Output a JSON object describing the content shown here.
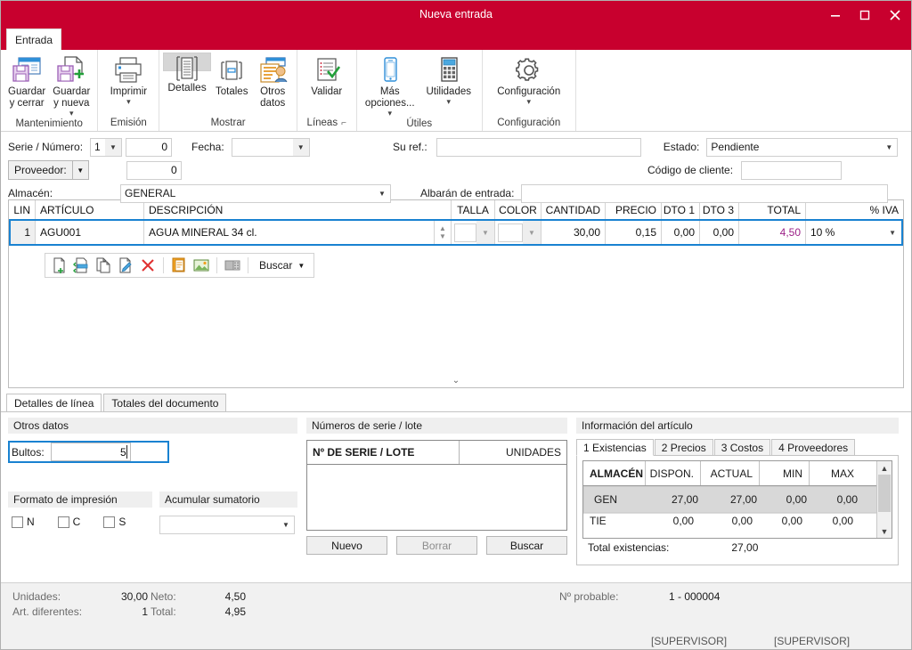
{
  "window": {
    "title": "Nueva entrada",
    "minimize": "–",
    "maximize": "□",
    "close": "✕"
  },
  "ribbon": {
    "tab_label": "Entrada",
    "groups": [
      {
        "label": "Mantenimiento",
        "buttons": [
          {
            "label": "Guardar\ny cerrar",
            "icon": "save-close-icon",
            "caret": false
          },
          {
            "label": "Guardar\ny nueva",
            "icon": "save-new-icon",
            "caret": true
          }
        ]
      },
      {
        "label": "Emisión",
        "buttons": [
          {
            "label": "Imprimir",
            "icon": "printer-icon",
            "caret": true
          }
        ]
      },
      {
        "label": "Mostrar",
        "buttons": [
          {
            "label": "Detalles",
            "icon": "details-icon",
            "caret": false,
            "selected": true
          },
          {
            "label": "Totales",
            "icon": "totals-icon",
            "caret": false
          },
          {
            "label": "Otros\ndatos",
            "icon": "other-data-icon",
            "caret": false
          }
        ]
      },
      {
        "label": "Líneas",
        "dialog_launcher": "⊿",
        "buttons": [
          {
            "label": "Validar",
            "icon": "validate-icon",
            "caret": false
          }
        ]
      },
      {
        "label": "Útiles",
        "buttons": [
          {
            "label": "Más\nopciones...",
            "icon": "more-options-icon",
            "caret": true
          },
          {
            "label": "Utilidades",
            "icon": "utilities-icon",
            "caret": true
          }
        ]
      },
      {
        "label": "Configuración",
        "buttons": [
          {
            "label": "Configuración",
            "icon": "gear-icon",
            "caret": true
          }
        ]
      }
    ]
  },
  "header_form": {
    "serie_numero_label": "Serie / Número:",
    "serie_value": "1",
    "numero_value": "0",
    "fecha_label": "Fecha:",
    "fecha_value": "",
    "su_ref_label": "Su ref.:",
    "su_ref_value": "",
    "estado_label": "Estado:",
    "estado_value": "Pendiente",
    "proveedor_label": "Proveedor:",
    "proveedor_value": "0",
    "codigo_cliente_label": "Código de cliente:",
    "codigo_cliente_value": "",
    "almacen_label": "Almacén:",
    "almacen_value": "GENERAL",
    "albaran_label": "Albarán de entrada:",
    "albaran_value": ""
  },
  "lines_grid": {
    "columns": [
      "LIN",
      "ARTÍCULO",
      "DESCRIPCIÓN",
      "TALLA",
      "COLOR",
      "CANTIDAD",
      "PRECIO",
      "DTO 1",
      "DTO 3",
      "TOTAL",
      "% IVA"
    ],
    "rows": [
      {
        "lin": "1",
        "articulo": "AGU001",
        "descripcion": "AGUA MINERAL 34 cl.",
        "talla": "",
        "color": "",
        "cantidad": "30,00",
        "precio": "0,15",
        "dto1": "0,00",
        "dto3": "0,00",
        "total": "4,50",
        "iva": "10 %"
      }
    ],
    "toolbar": {
      "icons": [
        "new-line-icon",
        "insert-line-icon",
        "copy-line-icon",
        "edit-line-icon",
        "delete-line-icon",
        "note-icon",
        "image-icon",
        "stock-icon"
      ],
      "buscar_label": "Buscar"
    },
    "collapse_icon": "chevron-down-icon"
  },
  "bottom_tabs": [
    {
      "label": "Detalles de línea",
      "active": true
    },
    {
      "label": "Totales del documento",
      "active": false
    }
  ],
  "otros_datos": {
    "title": "Otros datos",
    "bultos_label": "Bultos:",
    "bultos_value": "5",
    "formato_title": "Formato de impresión",
    "acumular_title": "Acumular sumatorio",
    "acumular_value": "",
    "checkboxes": [
      {
        "label": "N",
        "checked": false
      },
      {
        "label": "C",
        "checked": false
      },
      {
        "label": "S",
        "checked": false
      }
    ]
  },
  "serie_lote": {
    "title": "Números de serie / lote",
    "columns": [
      "Nº DE SERIE / LOTE",
      "UNIDADES"
    ],
    "rows": [],
    "buttons": [
      {
        "label": "Nuevo",
        "enabled": true
      },
      {
        "label": "Borrar",
        "enabled": false
      },
      {
        "label": "Buscar",
        "enabled": true
      }
    ]
  },
  "info_articulo": {
    "title": "Información del artículo",
    "tabs": [
      {
        "label": "1 Existencias",
        "active": true
      },
      {
        "label": "2 Precios",
        "active": false
      },
      {
        "label": "3 Costos",
        "active": false
      },
      {
        "label": "4 Proveedores",
        "active": false
      }
    ],
    "columns": [
      "ALMACÉN",
      "DISPON.",
      "ACTUAL",
      "MIN",
      "MAX"
    ],
    "rows": [
      {
        "almacen": "GEN",
        "dispon": "27,00",
        "actual": "27,00",
        "min": "0,00",
        "max": "0,00",
        "selected": true
      },
      {
        "almacen": "TIE",
        "dispon": "0,00",
        "actual": "0,00",
        "min": "0,00",
        "max": "0,00",
        "selected": false
      }
    ],
    "total_label": "Total existencias:",
    "total_value": "27,00"
  },
  "statusbar": {
    "unidades_label": "Unidades:",
    "unidades_value": "30,00",
    "neto_label": "Neto:",
    "neto_value": "4,50",
    "art_label": "Art. diferentes:",
    "art_value": "1",
    "total_label": "Total:",
    "total_value": "4,95",
    "probable_label": "Nº probable:",
    "probable_value": "1 - 000004",
    "user_left": "[SUPERVISOR]",
    "user_right": "[SUPERVISOR]"
  },
  "colors": {
    "brand_red": "#c8002e",
    "accent_blue": "#1982d1",
    "total_magenta": "#9b1f87"
  }
}
